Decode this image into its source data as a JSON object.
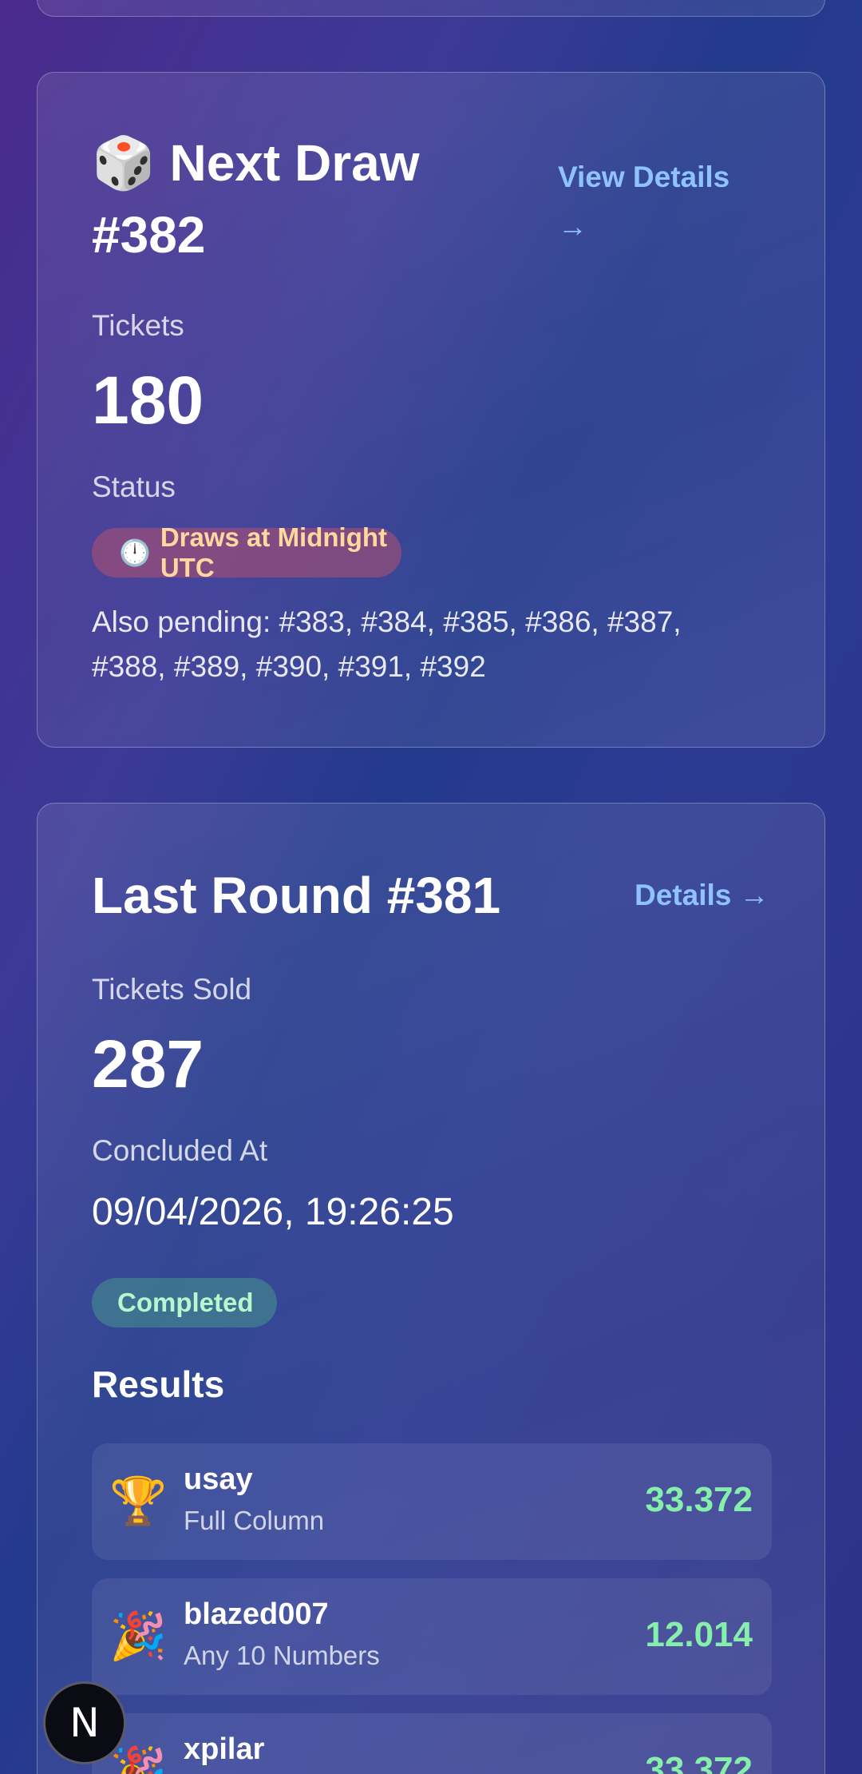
{
  "next_draw": {
    "icon": "🎲",
    "title": "Next Draw #382",
    "link_label": "View Details →",
    "tickets_label": "Tickets",
    "tickets_value": "180",
    "status_label": "Status",
    "status_icon": "🕛",
    "status_text": "Draws at Midnight UTC",
    "pending_text": "Also pending: #383, #384, #385, #386, #387, #388, #389, #390, #391, #392"
  },
  "last_round": {
    "title": "Last Round #381",
    "link_label": "Details →",
    "tickets_sold_label": "Tickets Sold",
    "tickets_sold_value": "287",
    "concluded_label": "Concluded At",
    "concluded_value": "09/04/2026, 19:26:25",
    "status_badge": "Completed",
    "results_title": "Results",
    "results": [
      {
        "icon": "🏆",
        "icon_name": "trophy-icon",
        "name": "usay",
        "type": "Full Column",
        "amount": "33.372"
      },
      {
        "icon": "🎉",
        "icon_name": "party-popper-icon",
        "name": "blazed007",
        "type": "Any 10 Numbers",
        "amount": "12.014"
      },
      {
        "icon": "🎉",
        "icon_name": "party-popper-icon",
        "name": "xpilar",
        "type": "",
        "amount": "33.372"
      }
    ]
  },
  "fab": {
    "label": "N",
    "icon_name": "nextjs-logo-icon"
  },
  "colors": {
    "link": "#8ec3ff",
    "amount": "#86efac",
    "status_pill_text": "#ffd8a0",
    "completed_text": "#b9f6cf"
  }
}
